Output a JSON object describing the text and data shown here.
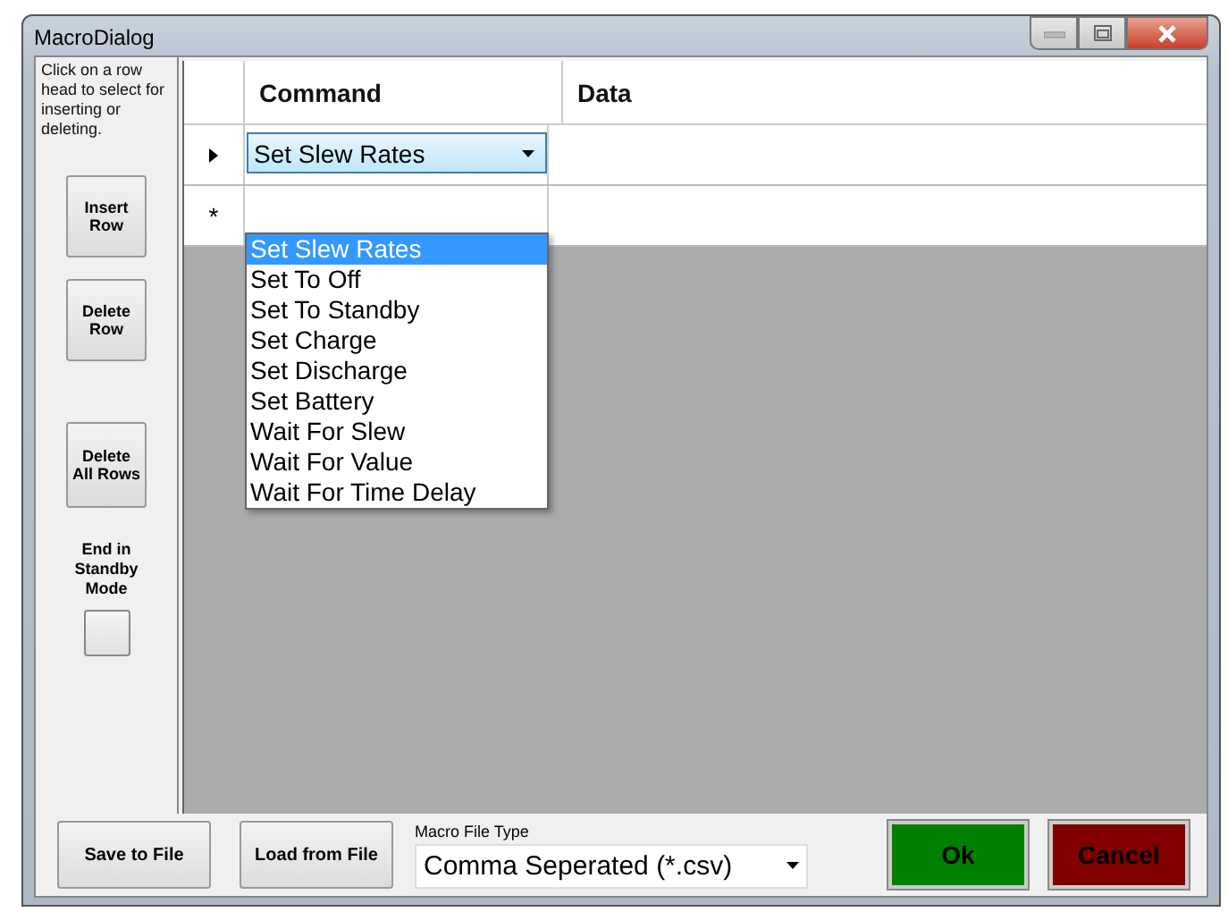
{
  "window": {
    "title": "MacroDialog"
  },
  "instructions": "Click on a row head to select for inserting or deleting.",
  "side_buttons": [
    "Insert Row",
    "Delete Row",
    "Delete All Rows"
  ],
  "standby": {
    "label": "End in Standby Mode",
    "checked": false
  },
  "grid": {
    "columns": [
      "Command",
      "Data"
    ],
    "rows": [
      {
        "kind": "current",
        "command": "Set Slew Rates"
      },
      {
        "kind": "new",
        "header": "*"
      }
    ],
    "dropdown": {
      "expanded": true,
      "options": [
        {
          "label": "Set Slew Rates",
          "selected": true
        },
        {
          "label": "Set To Off",
          "selected": false
        },
        {
          "label": "Set To Standby",
          "selected": false
        },
        {
          "label": "Set Charge",
          "selected": false
        },
        {
          "label": "Set Discharge",
          "selected": false
        },
        {
          "label": "Set Battery",
          "selected": false
        },
        {
          "label": "Wait For Slew",
          "selected": false
        },
        {
          "label": "Wait For Value",
          "selected": false
        },
        {
          "label": "Wait For Time Delay",
          "selected": false
        }
      ]
    }
  },
  "file_buttons": [
    "Save to File",
    "Load from File"
  ],
  "file_type": {
    "label": "Macro File Type",
    "value": "Comma Seperated (*.csv)"
  },
  "dialog_buttons": [
    {
      "label": "Ok",
      "color": "#008000"
    },
    {
      "label": "Cancel",
      "color": "#800000"
    }
  ]
}
